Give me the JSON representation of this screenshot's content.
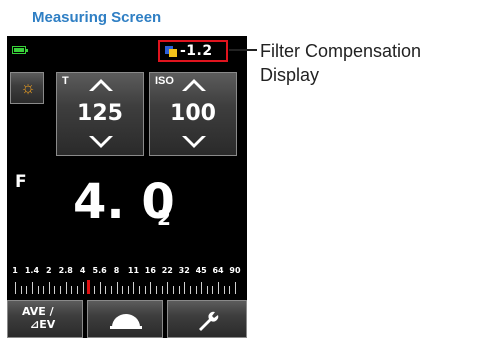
{
  "heading": "Measuring Screen",
  "status": {
    "battery_icon": "battery-full-icon",
    "filter_compensation_value": "-1.2",
    "filter_icon": "filter-icon"
  },
  "mode_button": {
    "icon": "sun-icon"
  },
  "shutter": {
    "label": "T",
    "value": "125"
  },
  "iso": {
    "label": "ISO",
    "value": "100"
  },
  "aperture": {
    "label": "F",
    "main": "4. 0",
    "tenths": "2"
  },
  "scale": {
    "labels": [
      "1",
      "1.4",
      "2",
      "2.8",
      "4",
      "5.6",
      "8",
      "11",
      "16",
      "22",
      "32",
      "45",
      "64",
      "90"
    ],
    "marker_value": "4"
  },
  "bottom": {
    "ave_line1": "AVE /",
    "ave_line2": "⊿EV",
    "dome_icon": "lumisphere-icon",
    "tool_icon": "wrench-icon"
  },
  "callout": {
    "line1": "Filter Compensation",
    "line2": "Display"
  },
  "colors": {
    "heading": "#2f7fc4",
    "highlight_box": "#e0141e",
    "battery": "#39d13a"
  }
}
